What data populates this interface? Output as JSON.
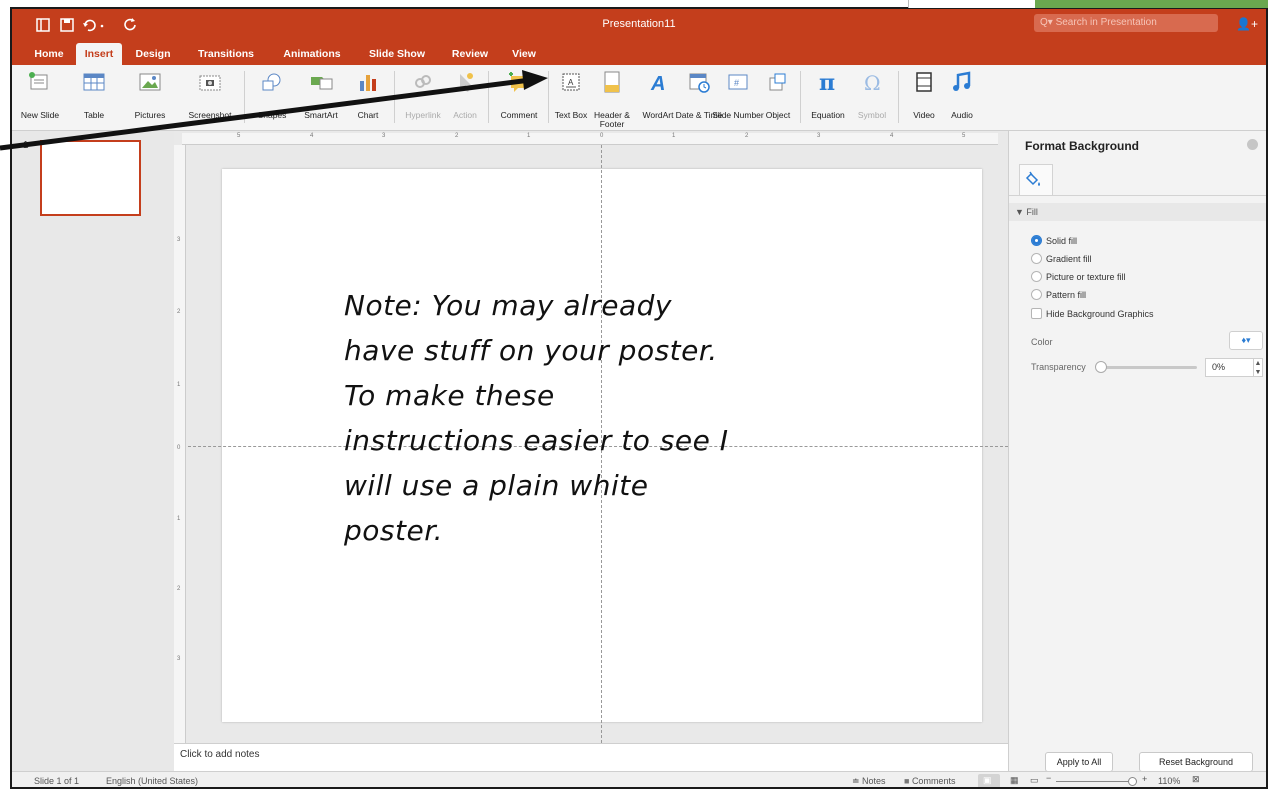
{
  "window": {
    "title": "Presentation11",
    "search_placeholder": "Search in Presentation"
  },
  "tabs": [
    "Home",
    "Insert",
    "Design",
    "Transitions",
    "Animations",
    "Slide Show",
    "Review",
    "View"
  ],
  "active_tab": "Insert",
  "ribbon": {
    "new_slide": "New Slide",
    "table": "Table",
    "pictures": "Pictures",
    "screenshot": "Screenshot",
    "shapes": "Shapes",
    "smartart": "SmartArt",
    "chart": "Chart",
    "hyperlink": "Hyperlink",
    "action": "Action",
    "comment": "Comment",
    "text_box": "Text Box",
    "header_footer": "Header & Footer",
    "wordart": "WordArt",
    "date_time": "Date & Time",
    "slide_number": "Slide Number",
    "object": "Object",
    "equation": "Equation",
    "symbol": "Symbol",
    "video": "Video",
    "audio": "Audio"
  },
  "thumbnails": {
    "slide_number": "1"
  },
  "ruler": {
    "h_ticks": [
      "5",
      "4",
      "3",
      "2",
      "1",
      "0",
      "1",
      "2",
      "3",
      "4",
      "5"
    ],
    "v_ticks": [
      "3",
      "2",
      "1",
      "0",
      "1",
      "2",
      "3"
    ]
  },
  "slide": {
    "note_lines": [
      "Note: You may already",
      "have stuff on your poster.",
      "To make these",
      "instructions easier to see I",
      "will use a plain white",
      "poster."
    ]
  },
  "notes": {
    "placeholder": "Click to add notes"
  },
  "format_pane": {
    "title": "Format Background",
    "section": "Fill",
    "options": [
      "Solid fill",
      "Gradient fill",
      "Picture or texture fill",
      "Pattern fill"
    ],
    "selected_option": "Solid fill",
    "hide_graphics": "Hide Background Graphics",
    "color_label": "Color",
    "transparency_label": "Transparency",
    "transparency_value": "0%",
    "apply_all": "Apply to All",
    "reset": "Reset Background"
  },
  "status": {
    "slide_of": "Slide 1 of 1",
    "language": "English (United States)",
    "notes": "Notes",
    "comments": "Comments",
    "zoom": "110%"
  },
  "colors": {
    "accent": "#c43e1c",
    "selected_radio": "#2b7cd3"
  }
}
